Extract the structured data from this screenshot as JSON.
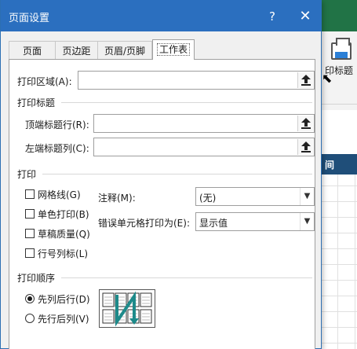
{
  "background": {
    "print_titles_label": "印标题",
    "column_header": "间"
  },
  "dialog": {
    "title": "页面设置",
    "help_label": "?",
    "close_label": "✕"
  },
  "tabs": [
    {
      "label": "页面"
    },
    {
      "label": "页边距"
    },
    {
      "label": "页眉/页脚"
    },
    {
      "label": "工作表",
      "active": true
    }
  ],
  "print_area": {
    "label": "打印区域(A):",
    "value": ""
  },
  "print_titles": {
    "section": "打印标题",
    "rows_label": "顶端标题行(R):",
    "rows_value": "",
    "cols_label": "左端标题列(C):",
    "cols_value": ""
  },
  "print": {
    "section": "打印",
    "checkboxes": [
      {
        "label": "网格线(G)",
        "checked": false
      },
      {
        "label": "单色打印(B)",
        "checked": false
      },
      {
        "label": "草稿质量(Q)",
        "checked": false
      },
      {
        "label": "行号列标(L)",
        "checked": false
      }
    ],
    "comments_label": "注释(M):",
    "comments_value": "(无)",
    "errors_label": "错误单元格打印为(E):",
    "errors_value": "显示值"
  },
  "page_order": {
    "section": "打印顺序",
    "options": [
      {
        "label": "先列后行(D)",
        "selected": true
      },
      {
        "label": "先行后列(V)",
        "selected": false
      }
    ]
  },
  "colors": {
    "titlebar": "#2b6fbf",
    "accent_green": "#217346",
    "order_arrow": "#1d8a8a"
  },
  "icons": {
    "reference_button": "collapse-dialog-icon",
    "dropdown": "chevron-down-icon",
    "printer": "printer-icon"
  }
}
